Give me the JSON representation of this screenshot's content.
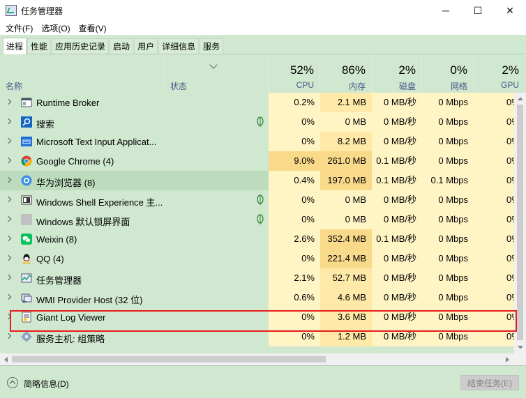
{
  "window": {
    "title": "任务管理器",
    "minimize": "─",
    "maximize": "☐",
    "close": "✕"
  },
  "menu": [
    "文件(F)",
    "选项(O)",
    "查看(V)"
  ],
  "tabs": [
    {
      "label": "进程",
      "active": true
    },
    {
      "label": "性能",
      "active": false
    },
    {
      "label": "应用历史记录",
      "active": false
    },
    {
      "label": "启动",
      "active": false
    },
    {
      "label": "用户",
      "active": false
    },
    {
      "label": "详细信息",
      "active": false
    },
    {
      "label": "服务",
      "active": false
    }
  ],
  "columns": {
    "name": "名称",
    "status": "状态",
    "cpu": {
      "pct": "52%",
      "label": "CPU"
    },
    "memory": {
      "pct": "86%",
      "label": "内存"
    },
    "disk": {
      "pct": "2%",
      "label": "磁盘"
    },
    "network": {
      "pct": "0%",
      "label": "网络"
    },
    "gpu": {
      "pct": "2%",
      "label": "GPU"
    }
  },
  "processes": [
    {
      "name": "Runtime Broker",
      "icon": "runtime-broker-icon",
      "leaf": false,
      "cpu": "0.2%",
      "mem": "2.1 MB",
      "disk": "0 MB/秒",
      "net": "0 Mbps",
      "gpu": "0%"
    },
    {
      "name": "搜索",
      "icon": "search-icon",
      "leaf": true,
      "cpu": "0%",
      "mem": "0 MB",
      "disk": "0 MB/秒",
      "net": "0 Mbps",
      "gpu": "0%"
    },
    {
      "name": "Microsoft Text Input Applicat...",
      "icon": "keyboard-icon",
      "leaf": false,
      "cpu": "0%",
      "mem": "8.2 MB",
      "disk": "0 MB/秒",
      "net": "0 Mbps",
      "gpu": "0%"
    },
    {
      "name": "Google Chrome (4)",
      "icon": "chrome-icon",
      "leaf": false,
      "cpu": "9.0%",
      "mem": "261.0 MB",
      "disk": "0.1 MB/秒",
      "net": "0 Mbps",
      "gpu": "0%"
    },
    {
      "name": "华为浏览器 (8)",
      "icon": "huawei-browser-icon",
      "leaf": false,
      "cpu": "0.4%",
      "mem": "197.0 MB",
      "disk": "0.1 MB/秒",
      "net": "0.1 Mbps",
      "gpu": "0%"
    },
    {
      "name": "Windows Shell Experience 主...",
      "icon": "shell-experience-icon",
      "leaf": true,
      "cpu": "0%",
      "mem": "0 MB",
      "disk": "0 MB/秒",
      "net": "0 Mbps",
      "gpu": "0%"
    },
    {
      "name": "Windows 默认锁屏界面",
      "icon": "lockscreen-icon",
      "leaf": true,
      "cpu": "0%",
      "mem": "0 MB",
      "disk": "0 MB/秒",
      "net": "0 Mbps",
      "gpu": "0%"
    },
    {
      "name": "Weixin (8)",
      "icon": "weixin-icon",
      "leaf": false,
      "cpu": "2.6%",
      "mem": "352.4 MB",
      "disk": "0.1 MB/秒",
      "net": "0 Mbps",
      "gpu": "0%"
    },
    {
      "name": "QQ (4)",
      "icon": "qq-icon",
      "leaf": false,
      "cpu": "0%",
      "mem": "221.4 MB",
      "disk": "0 MB/秒",
      "net": "0 Mbps",
      "gpu": "0%"
    },
    {
      "name": "任务管理器",
      "icon": "task-manager-icon",
      "leaf": false,
      "cpu": "2.1%",
      "mem": "52.7 MB",
      "disk": "0 MB/秒",
      "net": "0 Mbps",
      "gpu": "0%"
    },
    {
      "name": "WMI Provider Host (32 位)",
      "icon": "wmi-icon",
      "leaf": false,
      "cpu": "0.6%",
      "mem": "4.6 MB",
      "disk": "0 MB/秒",
      "net": "0 Mbps",
      "gpu": "0%"
    },
    {
      "name": "Giant Log Viewer",
      "icon": "log-viewer-icon",
      "leaf": false,
      "cpu": "0%",
      "mem": "3.6 MB",
      "disk": "0 MB/秒",
      "net": "0 Mbps",
      "gpu": "0%"
    },
    {
      "name": "服务主机: 组策略",
      "icon": "service-host-icon",
      "leaf": false,
      "cpu": "0%",
      "mem": "1.2 MB",
      "disk": "0 MB/秒",
      "net": "0 Mbps",
      "gpu": "0%"
    }
  ],
  "footer": {
    "fewer_details": "简略信息(D)",
    "end_task": "结束任务(E)"
  }
}
